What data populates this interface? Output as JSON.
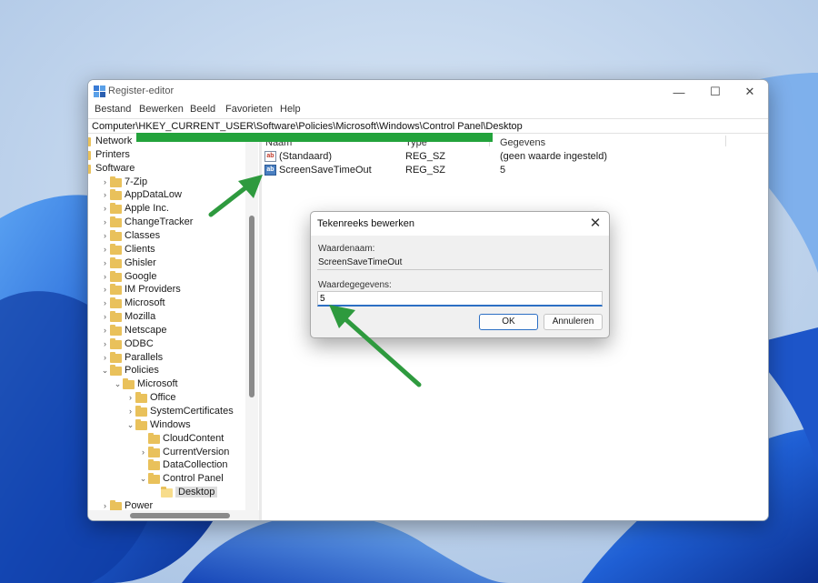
{
  "window": {
    "title": "Register-editor",
    "controls": {
      "minimize": "—",
      "maximize": "☐",
      "close": "✕"
    }
  },
  "menu": [
    "Bestand",
    "Bewerken",
    "Beeld",
    "Favorieten",
    "Help"
  ],
  "address": "Computer\\HKEY_CURRENT_USER\\Software\\Policies\\Microsoft\\Windows\\Control Panel\\Desktop",
  "tree": [
    {
      "label": "Network",
      "depth": 0,
      "chevron": "",
      "folder": false
    },
    {
      "label": "Printers",
      "depth": 0,
      "chevron": "",
      "folder": false
    },
    {
      "label": "Software",
      "depth": 0,
      "chevron": "",
      "folder": false
    },
    {
      "label": "7-Zip",
      "depth": 1,
      "chevron": "›",
      "folder": true
    },
    {
      "label": "AppDataLow",
      "depth": 1,
      "chevron": "›",
      "folder": true
    },
    {
      "label": "Apple Inc.",
      "depth": 1,
      "chevron": "›",
      "folder": true
    },
    {
      "label": "ChangeTracker",
      "depth": 1,
      "chevron": "›",
      "folder": true
    },
    {
      "label": "Classes",
      "depth": 1,
      "chevron": "›",
      "folder": true
    },
    {
      "label": "Clients",
      "depth": 1,
      "chevron": "›",
      "folder": true
    },
    {
      "label": "Ghisler",
      "depth": 1,
      "chevron": "›",
      "folder": true
    },
    {
      "label": "Google",
      "depth": 1,
      "chevron": "›",
      "folder": true
    },
    {
      "label": "IM Providers",
      "depth": 1,
      "chevron": "›",
      "folder": true
    },
    {
      "label": "Microsoft",
      "depth": 1,
      "chevron": "›",
      "folder": true
    },
    {
      "label": "Mozilla",
      "depth": 1,
      "chevron": "›",
      "folder": true
    },
    {
      "label": "Netscape",
      "depth": 1,
      "chevron": "›",
      "folder": true
    },
    {
      "label": "ODBC",
      "depth": 1,
      "chevron": "›",
      "folder": true
    },
    {
      "label": "Parallels",
      "depth": 1,
      "chevron": "›",
      "folder": true
    },
    {
      "label": "Policies",
      "depth": 1,
      "chevron": "⌄",
      "folder": true
    },
    {
      "label": "Microsoft",
      "depth": 2,
      "chevron": "⌄",
      "folder": true
    },
    {
      "label": "Office",
      "depth": 3,
      "chevron": "›",
      "folder": true
    },
    {
      "label": "SystemCertificates",
      "depth": 3,
      "chevron": "›",
      "folder": true
    },
    {
      "label": "Windows",
      "depth": 3,
      "chevron": "⌄",
      "folder": true
    },
    {
      "label": "CloudContent",
      "depth": 4,
      "chevron": "",
      "folder": true
    },
    {
      "label": "CurrentVersion",
      "depth": 4,
      "chevron": "›",
      "folder": true
    },
    {
      "label": "DataCollection",
      "depth": 4,
      "chevron": "",
      "folder": true
    },
    {
      "label": "Control Panel",
      "depth": 4,
      "chevron": "⌄",
      "folder": true
    },
    {
      "label": "Desktop",
      "depth": 5,
      "chevron": "",
      "folder": true,
      "selected": true
    },
    {
      "label": "Power",
      "depth": 1,
      "chevron": "›",
      "folder": true
    }
  ],
  "list": {
    "columns": [
      "Naam",
      "Type",
      "Gegevens"
    ],
    "rows": [
      {
        "icon": "string-value-icon",
        "name": "(Standaard)",
        "type": "REG_SZ",
        "data": "(geen waarde ingesteld)"
      },
      {
        "icon": "binary-value-icon",
        "name": "ScreenSaveTimeOut",
        "type": "REG_SZ",
        "data": "5"
      }
    ]
  },
  "dialog": {
    "title": "Tekenreeks bewerken",
    "close": "✕",
    "name_label": "Waardenaam:",
    "name_value": "ScreenSaveTimeOut",
    "data_label": "Waardegegevens:",
    "data_value": "5",
    "ok_label": "OK",
    "cancel_label": "Annuleren"
  },
  "colors": {
    "highlight_green": "#23a33c",
    "arrow_green": "#2e9a3e",
    "accent_blue": "#2c6fc4",
    "folder_yellow": "#e9c15b"
  }
}
